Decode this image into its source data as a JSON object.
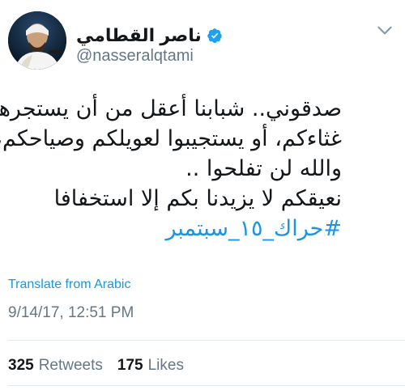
{
  "author": {
    "display_name": "ناصر القطامي",
    "handle": "@nasseralqtami"
  },
  "tweet": {
    "lines": [
      "صدقوني.. شبابنا أعقل من أن يستجرهم",
      "غثاءكم، أو يستجيبوا لعويلكم وصياحكم،",
      "والله لن تفلحوا ..",
      "نعيقكم لا يزيدنا بكم إلا استخفافا"
    ],
    "hashtag": "#حراك_١٥_سبتمبر"
  },
  "translate_label": "Translate from Arabic",
  "timestamp": "9/14/17, 12:51 PM",
  "stats": {
    "retweets_count": "325",
    "retweets_label": "Retweets",
    "likes_count": "175",
    "likes_label": "Likes"
  },
  "icons": {
    "verified": "verified-badge-icon",
    "more": "chevron-down-icon"
  },
  "colors": {
    "link": "#1b95e0",
    "verified": "#1da1f2"
  }
}
